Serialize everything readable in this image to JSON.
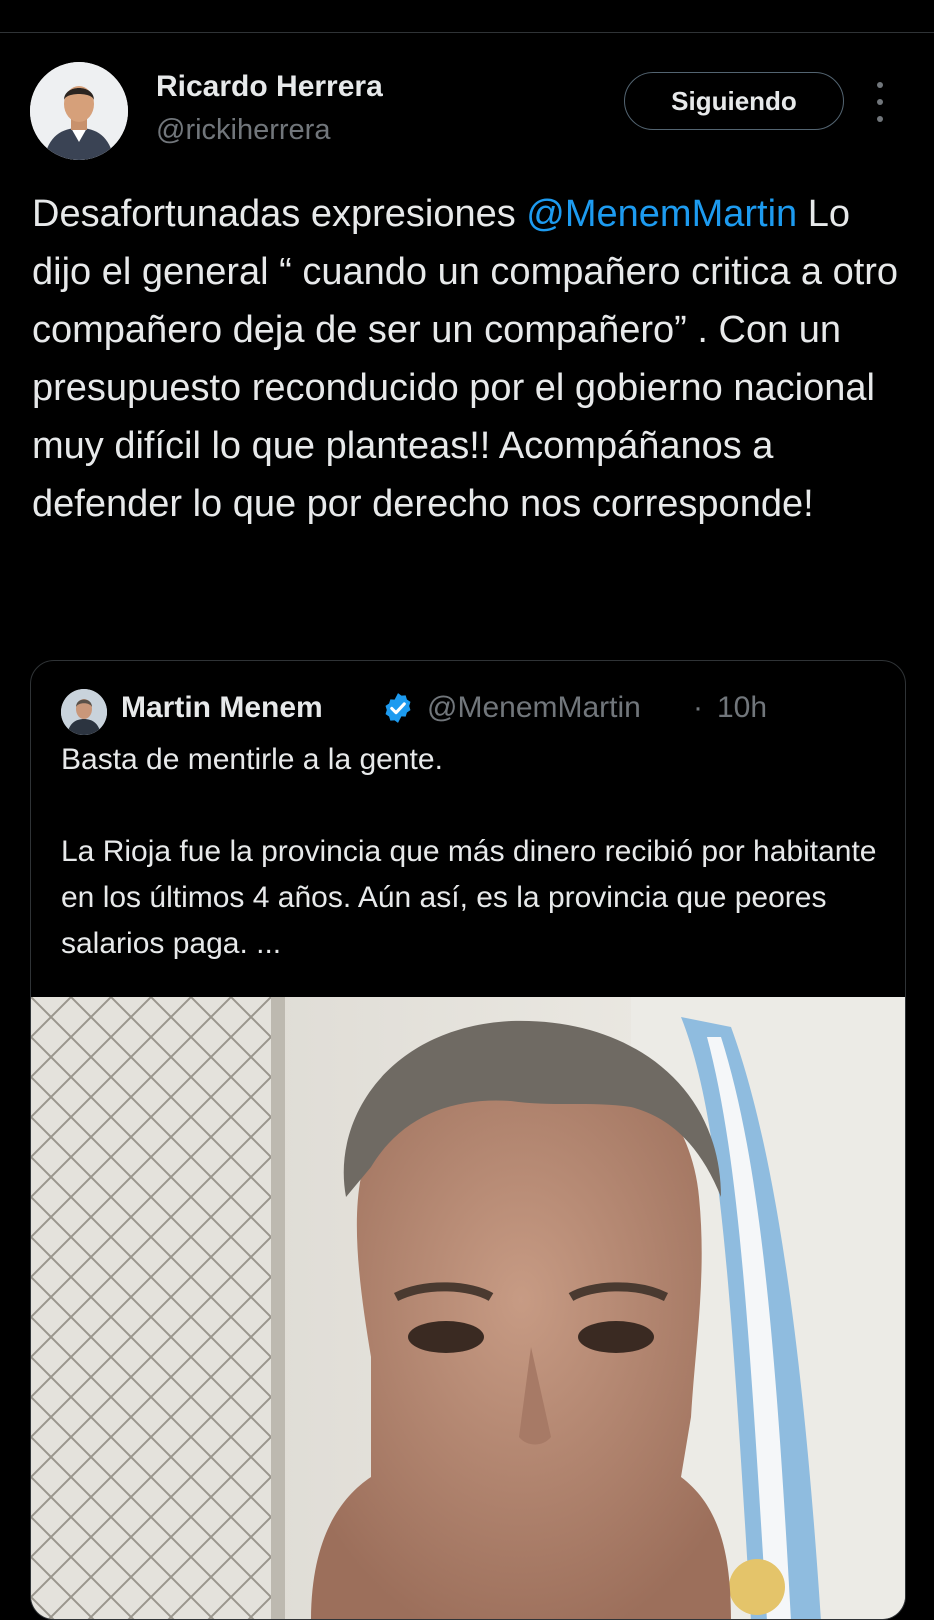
{
  "tweet": {
    "author_name": "Ricardo Herrera",
    "author_handle": "@rickiherrera",
    "follow_label": "Siguiendo",
    "text_before_mention": "Desafortunadas expresiones ",
    "mention": "@MenemMartin",
    "text_after_mention": " Lo dijo el general “ cuando un compañero critica a otro compañero deja de ser un compañero” . Con un presupuesto reconducido por el gobierno nacional muy difícil lo que planteas!! Acompáñanos a defender lo que por derecho nos corresponde!"
  },
  "quote": {
    "author_name": "Martin Menem",
    "author_handle": "@MenemMartin",
    "separator": "·",
    "time": "10h",
    "text_line1": "Basta de mentirle a la gente.",
    "text_paragraph2": "La Rioja fue la provincia que más dinero recibió por habitante en los últimos 4 años. Aún así, es la provincia que peores salarios paga. ..."
  },
  "icons": {
    "more": "more-vertical-icon",
    "verified": "verified-badge-icon"
  },
  "colors": {
    "background": "#000000",
    "text": "#e7e9ea",
    "secondary": "#71767b",
    "accent": "#1d9bf0",
    "border": "#2f3336"
  }
}
